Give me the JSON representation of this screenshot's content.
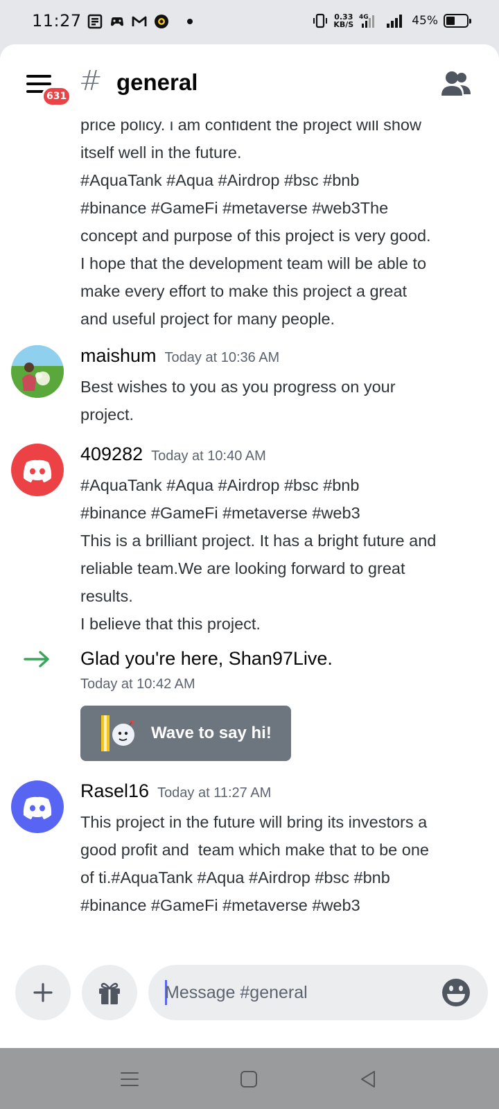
{
  "status_bar": {
    "time": "11:27",
    "net_speed_value": "0.33",
    "net_speed_unit": "KB/S",
    "network_type": "4G",
    "battery_percent": "45%",
    "battery_level": 0.45
  },
  "header": {
    "channel_prefix": "#",
    "channel_name": "general",
    "unread_badge": "631"
  },
  "messages": [
    {
      "text": "price policy. i am confident the project will show\nitself well in the future.\n#AquaTank #Aqua #Airdrop #bsc #bnb\n#binance #GameFi #metaverse #web3The\nconcept and purpose of this project is very good.\nI hope that the development team will be able to\nmake every effort to make this project a great\nand useful project for many people."
    },
    {
      "username": "maishum",
      "timestamp": "Today at 10:36 AM",
      "text": "Best wishes to you as you progress on your\nproject."
    },
    {
      "username": "409282",
      "timestamp": "Today at 10:40 AM",
      "text": "#AquaTank #Aqua #Airdrop #bsc #bnb\n#binance #GameFi #metaverse #web3\nThis is a brilliant project. It has a bright future and\nreliable team.We are looking forward to great\nresults.\nI believe that this project."
    },
    {
      "type": "join",
      "text_prefix": "Glad you're here, ",
      "username": "Shan97Live.",
      "timestamp": "Today at 10:42 AM",
      "wave_button_label": "Wave to say hi!"
    },
    {
      "username": "Rasel16",
      "timestamp": "Today at 11:27 AM",
      "text": "This project in the future will bring its investors a\ngood profit and  team which make that to be one\nof ti.#AquaTank #Aqua #Airdrop #bsc #bnb\n#binance #GameFi #metaverse #web3"
    }
  ],
  "composer": {
    "placeholder": "Message #general"
  },
  "colors": {
    "badge": "#ed4245",
    "avatar_red": "#ed4245",
    "avatar_blue": "#5865f2",
    "join_arrow": "#3ba55c",
    "wave_button": "#6d757e"
  }
}
